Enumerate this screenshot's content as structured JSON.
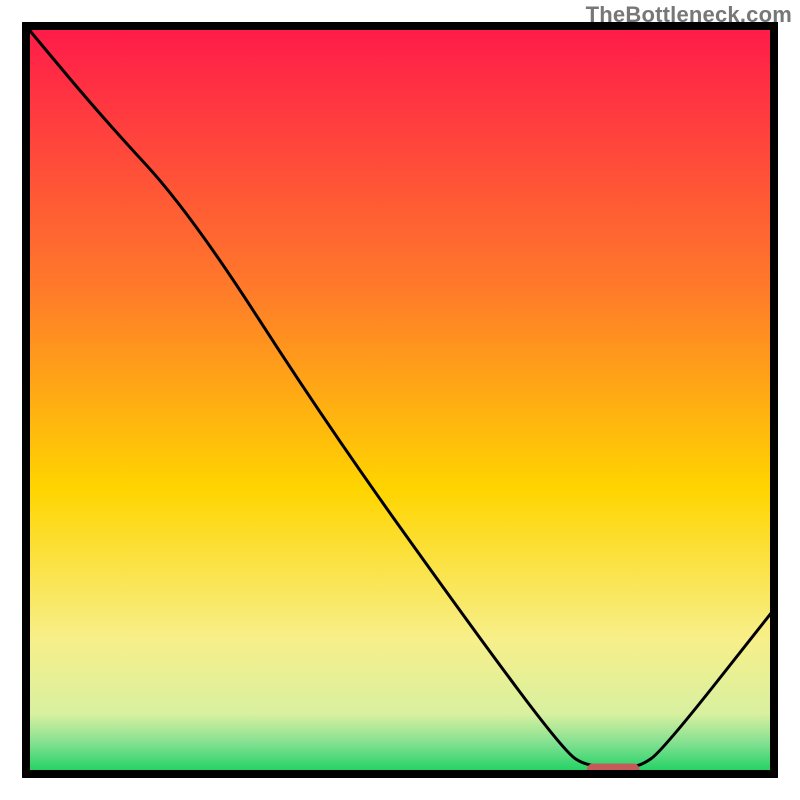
{
  "watermark": "TheBottleneck.com",
  "colors": {
    "gradient_top": "#ff1a4a",
    "gradient_upper": "#ff7a2a",
    "gradient_mid": "#ffd500",
    "gradient_lower": "#f7ef8a",
    "gradient_band": "#d8f0a0",
    "gradient_bottom": "#18d060",
    "curve": "#000000",
    "marker": "#c65a5a",
    "frame": "#000000"
  },
  "chart_data": {
    "type": "line",
    "title": "",
    "xlabel": "",
    "ylabel": "",
    "xlim": [
      0,
      100
    ],
    "ylim": [
      0,
      100
    ],
    "series": [
      {
        "name": "bottleneck-curve",
        "x": [
          0,
          10,
          22,
          40,
          60,
          72,
          75,
          80,
          82,
          85,
          100
        ],
        "y": [
          100,
          88,
          75,
          47,
          19,
          3,
          1,
          1,
          1,
          3,
          22
        ]
      }
    ],
    "marker": {
      "name": "optimal-range",
      "x_start": 75,
      "x_end": 82,
      "y": 0.6
    },
    "gradient_stops_pct": [
      0,
      35,
      62,
      82,
      92,
      96,
      100
    ]
  }
}
